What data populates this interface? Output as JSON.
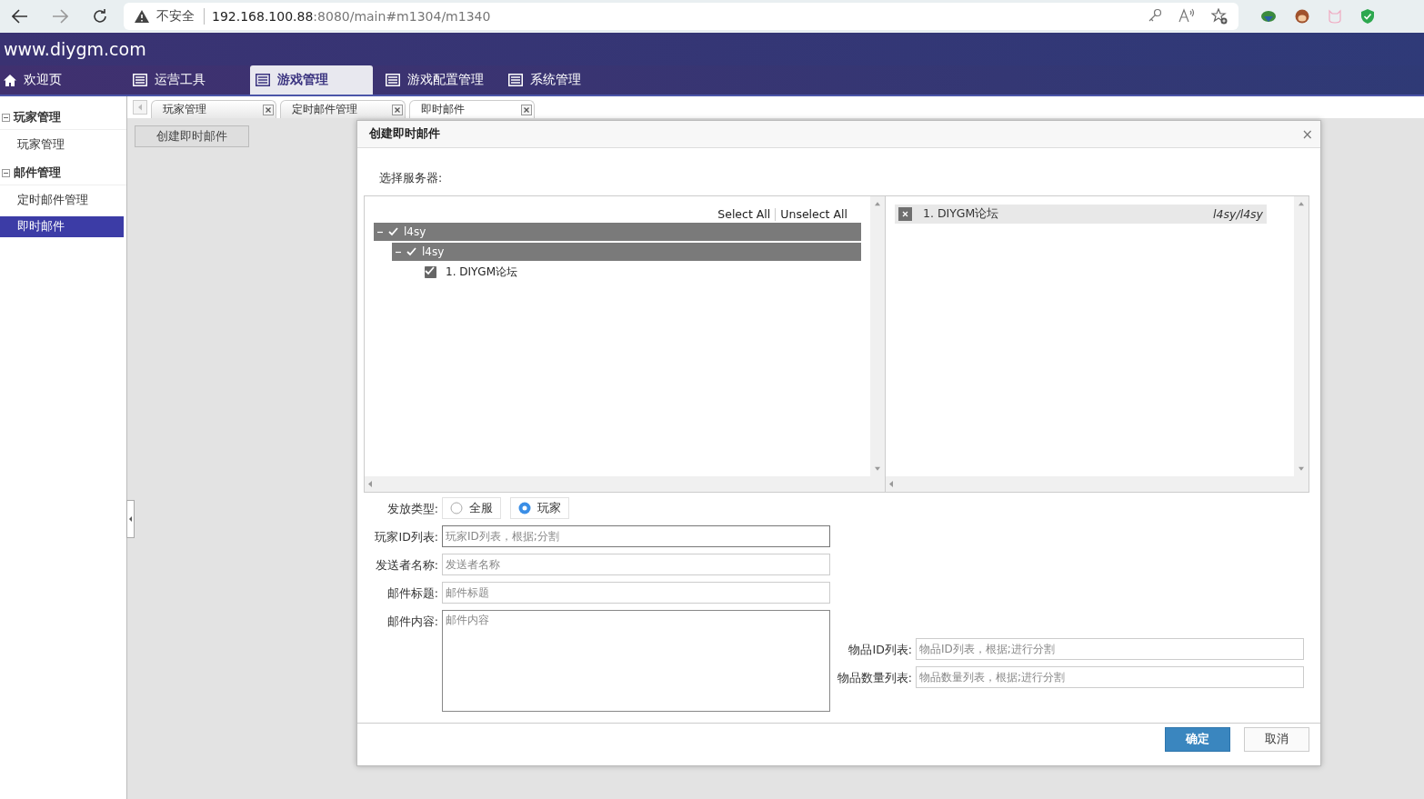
{
  "browser": {
    "security": "不安全",
    "url_host": "192.168.100.88",
    "url_path": ":8080/main#m1304/m1340"
  },
  "site": {
    "title": "www.diygm.com"
  },
  "nav": [
    {
      "label": "欢迎页",
      "selected": false
    },
    {
      "label": "运营工具",
      "selected": false
    },
    {
      "label": "游戏管理",
      "selected": true
    },
    {
      "label": "游戏配置管理",
      "selected": false
    },
    {
      "label": "系统管理",
      "selected": false
    }
  ],
  "sidebar": [
    {
      "label": "玩家管理",
      "expanded": true,
      "children": [
        {
          "label": "玩家管理",
          "selected": false
        }
      ]
    },
    {
      "label": "邮件管理",
      "expanded": true,
      "children": [
        {
          "label": "定时邮件管理",
          "selected": false
        },
        {
          "label": "即时邮件",
          "selected": true
        }
      ]
    }
  ],
  "page_tabs": [
    {
      "label": "玩家管理",
      "selected": false
    },
    {
      "label": "定时邮件管理",
      "selected": false
    },
    {
      "label": "即时邮件",
      "selected": true
    }
  ],
  "toolbar_button": "创建即时邮件",
  "dialog": {
    "title": "创建即时邮件",
    "close": "×",
    "server_label": "选择服务器:",
    "select_all": "Select All",
    "unselect_all": "Unselect All",
    "tree": [
      {
        "label": "l4sy",
        "kind": "group",
        "checked": true,
        "expanded": true,
        "children": [
          {
            "label": "l4sy",
            "kind": "group",
            "checked": true,
            "expanded": true,
            "children": [
              {
                "label": "1. DIYGM论坛",
                "kind": "server",
                "checked": true
              }
            ]
          }
        ]
      }
    ],
    "selected_servers": [
      {
        "name": "1. DIYGM论坛",
        "path": "l4sy/l4sy"
      }
    ],
    "send_type": {
      "label": "发放类型:",
      "options": [
        {
          "label": "全服",
          "selected": false
        },
        {
          "label": "玩家",
          "selected": true
        }
      ]
    },
    "fields": [
      {
        "label": "玩家ID列表:",
        "placeholder": "玩家ID列表，根据;分割",
        "kind": "input",
        "focused": true
      },
      {
        "label": "发送者名称:",
        "placeholder": "发送者名称",
        "kind": "input",
        "focused": false
      },
      {
        "label": "邮件标题:",
        "placeholder": "邮件标题",
        "kind": "input",
        "focused": false
      },
      {
        "label": "邮件内容:",
        "placeholder": "邮件内容",
        "kind": "textarea",
        "focused": true
      }
    ],
    "item_fields": [
      {
        "label": "物品ID列表:",
        "placeholder": "物品ID列表，根据;进行分割"
      },
      {
        "label": "物品数量列表:",
        "placeholder": "物品数量列表，根据;进行分割"
      }
    ],
    "buttons": [
      {
        "label": "确定",
        "kind": "primary"
      },
      {
        "label": "取消",
        "kind": "default"
      }
    ]
  }
}
